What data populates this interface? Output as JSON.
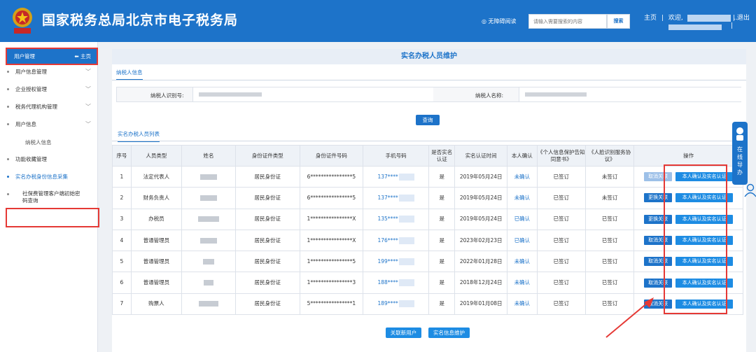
{
  "header": {
    "site_title": "国家税务总局北京市电子税务局",
    "accessible_label": "无障碍阅读",
    "search_placeholder": "请输入需要搜索的内容",
    "search_button": "搜索",
    "home_link": "主页",
    "welcome_prefix": "欢迎,",
    "welcome_suffix": "..",
    "logout_link": "退出",
    "separator": "|"
  },
  "sidebar": {
    "head_label": "用户管理",
    "head_home": "主页",
    "items": [
      {
        "label": "用户信息管理"
      },
      {
        "label": "企业授权管理"
      },
      {
        "label": "税务代理机构管理"
      },
      {
        "label": "用户信息"
      }
    ],
    "sub_item": "纳税人信息",
    "item_favorites": "功能收藏管理",
    "item_active": "实名办税身份信息采集",
    "item_social_line1": "社保费管理客户端初始密",
    "item_social_line2": "码查询"
  },
  "main": {
    "page_title": "实名办税人员维护",
    "tab_taxpayer": "纳税人信息",
    "taxpayer_id_label": "纳税人识别号:",
    "taxpayer_name_label": "纳税人名称:",
    "query_button": "查询",
    "tab_list": "实名办税人员列表",
    "table": {
      "headers": [
        "序号",
        "人员类型",
        "姓名",
        "身份证件类型",
        "身份证件号码",
        "手机号码",
        "是否实名认证",
        "实名认证时间",
        "本人确认",
        "《个人信息保护告知同意书》",
        "《人脸识别服务协议》",
        "操作"
      ],
      "rows": [
        {
          "no": "1",
          "type": "法定代表人",
          "id_type": "居民身份证",
          "id_no": "6****************5",
          "phone": "137****",
          "verified": "是",
          "time": "2019年05月24日",
          "confirm": "未确认",
          "consent": "已签订",
          "face": "未签订",
          "action1": "取消关联",
          "action1_style": "gray",
          "action2": "本人确认及实名认证"
        },
        {
          "no": "2",
          "type": "财务负责人",
          "id_type": "居民身份证",
          "id_no": "6****************5",
          "phone": "137****",
          "verified": "是",
          "time": "2019年05月24日",
          "confirm": "未确认",
          "consent": "已签订",
          "face": "未签订",
          "action1": "更换关联",
          "action1_style": "blue",
          "action2": "本人确认及实名认证"
        },
        {
          "no": "3",
          "type": "办税员",
          "id_type": "居民身份证",
          "id_no": "1****************X",
          "phone": "135****",
          "verified": "是",
          "time": "2019年05月24日",
          "confirm": "已确认",
          "consent": "已签订",
          "face": "已签订",
          "action1": "更换关联",
          "action1_style": "blue",
          "action2": "本人确认及实名认证"
        },
        {
          "no": "4",
          "type": "普通管理员",
          "id_type": "居民身份证",
          "id_no": "1****************X",
          "phone": "176****",
          "verified": "是",
          "time": "2023年02月23日",
          "confirm": "已确认",
          "consent": "已签订",
          "face": "已签订",
          "action1": "取消关联",
          "action1_style": "blue",
          "action2": "本人确认及实名认证"
        },
        {
          "no": "5",
          "type": "普通管理员",
          "id_type": "居民身份证",
          "id_no": "1****************5",
          "phone": "199****",
          "verified": "是",
          "time": "2022年01月28日",
          "confirm": "未确认",
          "consent": "已签订",
          "face": "已签订",
          "action1": "取消关联",
          "action1_style": "blue",
          "action2": "本人确认及实名认证"
        },
        {
          "no": "6",
          "type": "普通管理员",
          "id_type": "居民身份证",
          "id_no": "1****************3",
          "phone": "188****",
          "verified": "是",
          "time": "2018年12月24日",
          "confirm": "未确认",
          "consent": "已签订",
          "face": "已签订",
          "action1": "取消关联",
          "action1_style": "blue",
          "action2": "本人确认及实名认证"
        },
        {
          "no": "7",
          "type": "购票人",
          "id_type": "居民身份证",
          "id_no": "5****************1",
          "phone": "189****",
          "verified": "是",
          "time": "2019年01月08日",
          "confirm": "未确认",
          "consent": "已签订",
          "face": "已签订",
          "action1": "取消关联",
          "action1_style": "blue",
          "action2": "本人确认及实名认证"
        }
      ]
    },
    "bottom_link_user": "关联新用户",
    "bottom_realname": "实名信息维护"
  },
  "float_nav": {
    "label": "在线导办"
  },
  "colors": {
    "brand_blue": "#1d73c9",
    "highlight_red": "#e53935"
  }
}
